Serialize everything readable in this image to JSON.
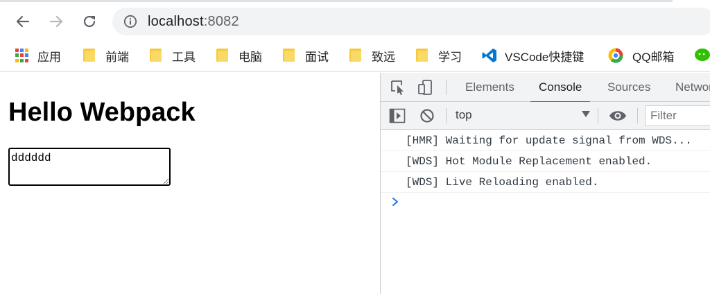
{
  "browser": {
    "url_host": "localhost",
    "url_port": ":8082",
    "icons": [
      "back-arrow-icon",
      "forward-arrow-icon",
      "reload-icon",
      "info-icon"
    ]
  },
  "bookmarks": [
    {
      "label": "应用",
      "icon": "apps-grid-icon"
    },
    {
      "label": "前端",
      "icon": "folder-icon"
    },
    {
      "label": "工具",
      "icon": "folder-icon"
    },
    {
      "label": "电脑",
      "icon": "folder-icon"
    },
    {
      "label": "面试",
      "icon": "folder-icon"
    },
    {
      "label": "致远",
      "icon": "folder-icon"
    },
    {
      "label": "学习",
      "icon": "folder-icon"
    },
    {
      "label": "VSCode快捷键",
      "icon": "vscode-icon"
    },
    {
      "label": "QQ邮箱",
      "icon": "qq-mail-icon"
    }
  ],
  "page": {
    "heading": "Hello Webpack",
    "textarea_value": "dddddd"
  },
  "devtools": {
    "tabs": [
      "Elements",
      "Console",
      "Sources",
      "Network"
    ],
    "active_tab": "Console",
    "context": "top",
    "filter_placeholder": "Filter",
    "logs": [
      "[HMR] Waiting for update signal from WDS...",
      "[WDS] Hot Module Replacement enabled.",
      "[WDS] Live Reloading enabled."
    ]
  },
  "colors": {
    "accent": "#1a73e8",
    "folder": "#f5c93d",
    "vscode": "#0078d4"
  }
}
